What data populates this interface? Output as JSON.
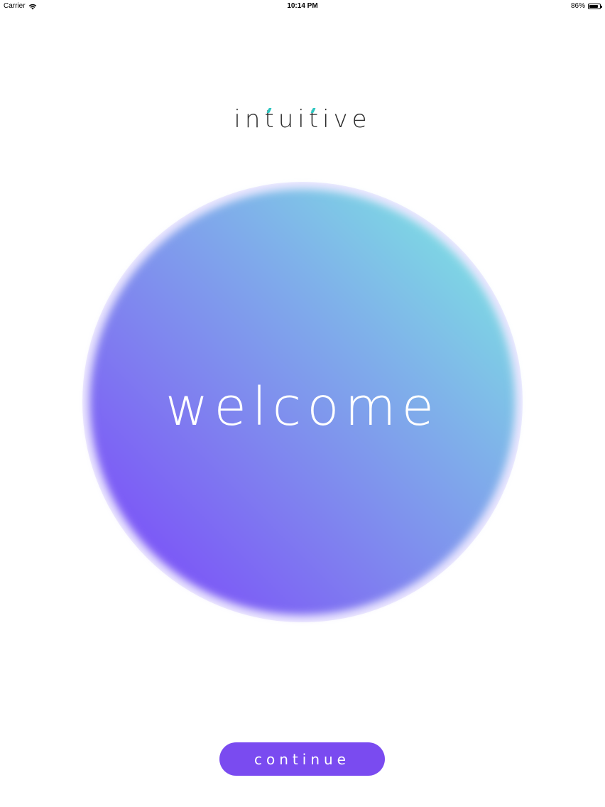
{
  "status_bar": {
    "carrier": "Carrier",
    "time": "10:14 PM",
    "battery_percent_text": "86%",
    "battery_level": 0.86
  },
  "logo": {
    "parts": [
      "in",
      "t",
      "ui",
      "t",
      "ive"
    ]
  },
  "hero": {
    "welcome_text": "welcome",
    "gradient_colors": [
      "#7a3ffb",
      "#7f7cf0",
      "#7fb0ea",
      "#7ef0e0"
    ]
  },
  "actions": {
    "continue_label": "continue",
    "button_color": "#7a4bf0"
  },
  "colors": {
    "logo_accent": "#2cc6c0",
    "logo_text": "#2b2b2b"
  }
}
